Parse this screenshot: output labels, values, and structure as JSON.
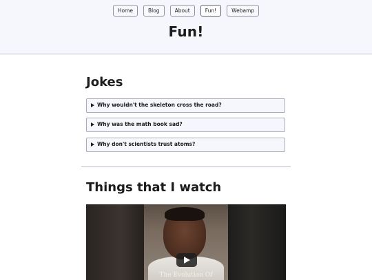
{
  "nav": {
    "items": [
      {
        "label": "Home"
      },
      {
        "label": "Blog"
      },
      {
        "label": "About"
      },
      {
        "label": "Fun!"
      },
      {
        "label": "Webamp"
      }
    ],
    "active": "Fun!"
  },
  "page": {
    "title": "Fun!"
  },
  "jokes": {
    "heading": "Jokes",
    "items": [
      {
        "question": "Why wouldn't the skeleton cross the road?"
      },
      {
        "question": "Why was the math book sad?"
      },
      {
        "question": "Why don't scientists trust atoms?"
      }
    ]
  },
  "watch": {
    "heading": "Things that I watch",
    "video": {
      "caption": "The Evolution Of"
    }
  },
  "colors": {
    "header_bg": "#f5f7fd",
    "border": "#b9bdc9",
    "text": "#1c1c1c"
  }
}
